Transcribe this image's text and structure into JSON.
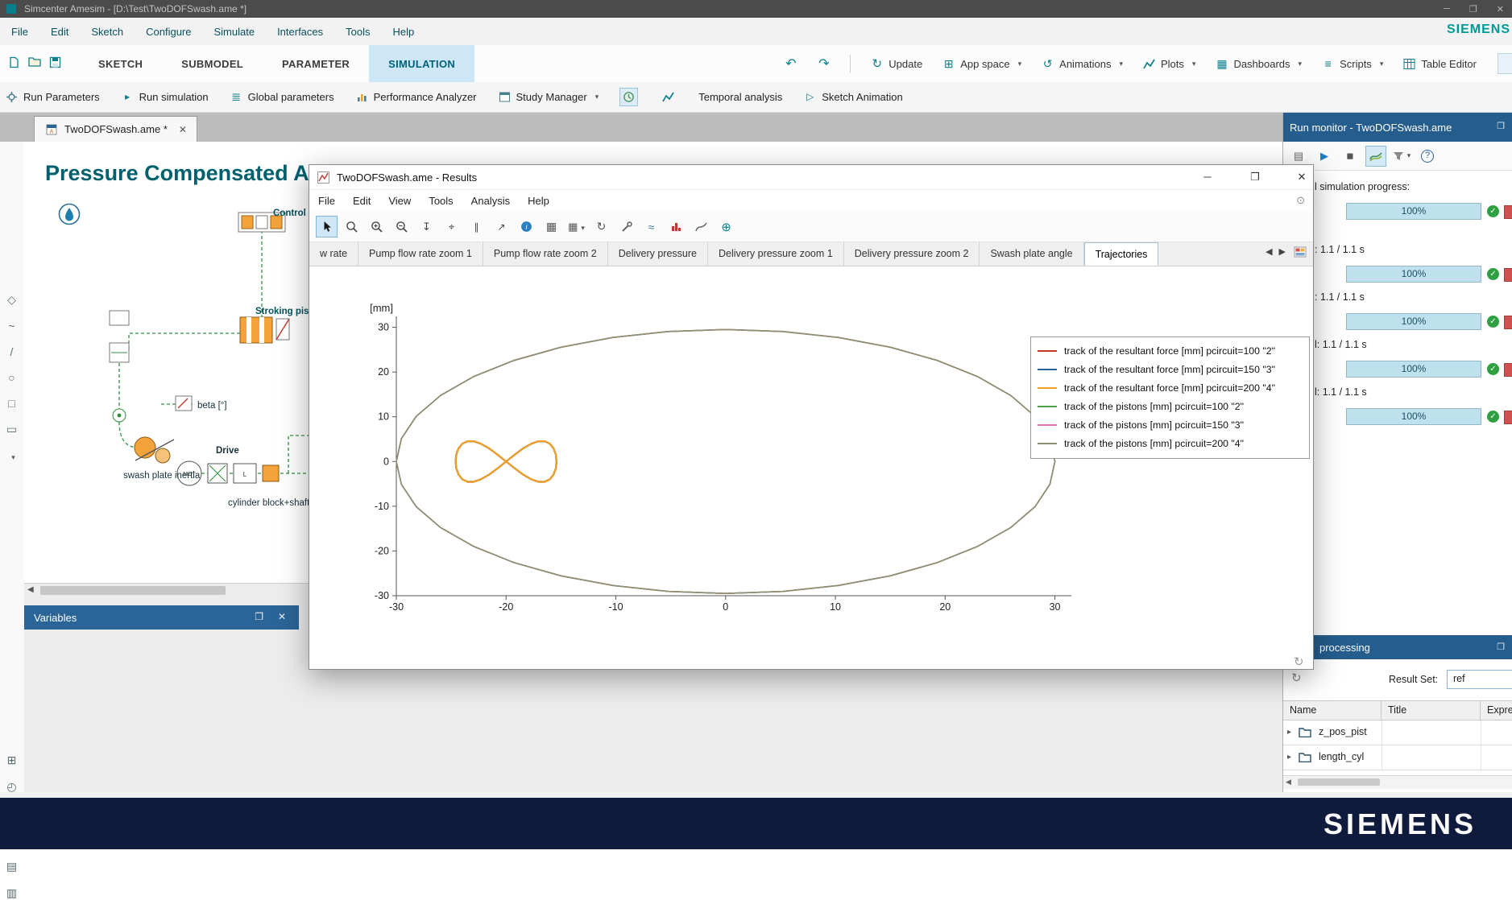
{
  "window": {
    "title": "Simcenter Amesim - [D:\\Test\\TwoDOFSwash.ame *]",
    "brand": "SIEMENS"
  },
  "menubar": {
    "items": [
      "File",
      "Edit",
      "Sketch",
      "Configure",
      "Simulate",
      "Interfaces",
      "Tools",
      "Help"
    ]
  },
  "mode_bar": {
    "file_actions": [
      "new",
      "open",
      "save"
    ],
    "tabs": [
      {
        "label": "SKETCH",
        "active": false
      },
      {
        "label": "SUBMODEL",
        "active": false
      },
      {
        "label": "PARAMETER",
        "active": false
      },
      {
        "label": "SIMULATION",
        "active": true
      }
    ],
    "actions": [
      {
        "label": "Update",
        "icon": "refresh",
        "chevron": false
      },
      {
        "label": "App space",
        "icon": "appspace",
        "chevron": true
      },
      {
        "label": "Animations",
        "icon": "animations",
        "chevron": true
      },
      {
        "label": "Plots",
        "icon": "plots",
        "chevron": true
      },
      {
        "label": "Dashboards",
        "icon": "dashboards",
        "chevron": true
      },
      {
        "label": "Scripts",
        "icon": "scripts",
        "chevron": true
      },
      {
        "label": "Table Editor",
        "icon": "tableeditor",
        "chevron": false
      }
    ]
  },
  "sim_toolbar": {
    "items": [
      {
        "label": "Run Parameters",
        "icon": "runparams",
        "chevron": false
      },
      {
        "label": "Run simulation",
        "icon": "runsim",
        "chevron": false
      },
      {
        "label": "Global parameters",
        "icon": "globalparams",
        "chevron": false
      },
      {
        "label": "Performance Analyzer",
        "icon": "perf",
        "chevron": false
      },
      {
        "label": "Study Manager",
        "icon": "study",
        "chevron": true
      },
      {
        "label": "",
        "icon": "temporal1",
        "chevron": false,
        "boxed": true
      },
      {
        "label": "",
        "icon": "temporal2",
        "chevron": false
      },
      {
        "label": "Temporal analysis",
        "icon": "",
        "chevron": false
      },
      {
        "label": "Sketch Animation",
        "icon": "sketchanim",
        "chevron": false
      }
    ]
  },
  "document_tabs": {
    "active": "TwoDOFSwash.ame *"
  },
  "left_rail": {
    "top": [
      "component",
      "signal",
      "line",
      "circle",
      "rect",
      "shape",
      "more"
    ],
    "bottom": [
      "grid",
      "clock",
      "plus",
      "target",
      "list",
      "panel"
    ]
  },
  "canvas": {
    "title": "Pressure Compensated Axial",
    "labels": {
      "control": "Control v",
      "stroking": "Stroking pist",
      "beta": "beta [°]",
      "swash": "swash plate inertia",
      "drive": "Drive",
      "cylinder": "cylinder block+shaft i"
    }
  },
  "variables_panel": {
    "title": "Variables"
  },
  "results_window": {
    "title": "TwoDOFSwash.ame - Results",
    "menus": [
      "File",
      "Edit",
      "View",
      "Tools",
      "Analysis",
      "Help"
    ],
    "toolbar": [
      "cursor",
      "zoomdyn",
      "zoomin",
      "zoomout",
      "markerv",
      "markerplus",
      "markerpair",
      "markerslope",
      "timeinfo",
      "table",
      "tablemenu",
      "refresh2",
      "tools",
      "waves",
      "histogram",
      "curveexp",
      "addcircle"
    ],
    "tabs": [
      "w rate",
      "Pump flow rate zoom 1",
      "Pump flow rate zoom 2",
      "Delivery pressure",
      "Delivery pressure zoom 1",
      "Delivery pressure zoom 2",
      "Swash plate angle",
      "Trajectories"
    ],
    "active_tab": "Trajectories"
  },
  "chart_data": {
    "type": "line",
    "title": "Trajectories",
    "xlabel": "",
    "ylabel": "[mm]",
    "xlim": [
      -30,
      31.5
    ],
    "ylim": [
      -30,
      31
    ],
    "xticks": [
      -30,
      -20,
      -10,
      0,
      10,
      20,
      30
    ],
    "yticks": [
      30,
      20,
      10,
      0,
      -10,
      -20,
      -30
    ],
    "grid": false,
    "legend_position": "upper right",
    "series": [
      {
        "name": "track of the resultant force [mm] pcircuit=100  \"2\"",
        "color": "#c0392b",
        "shape": "bowtie"
      },
      {
        "name": "track of the resultant force [mm] pcircuit=150  \"3\"",
        "color": "#2a6496",
        "shape": "bowtie"
      },
      {
        "name": "track of the resultant force [mm] pcircuit=200  \"4\"",
        "color": "#f0a125",
        "shape": "bowtie"
      },
      {
        "name": "track of the pistons [mm] pcircuit=100  \"2\"",
        "color": "#47a447",
        "shape": "ellipse"
      },
      {
        "name": "track of the pistons [mm] pcircuit=150  \"3\"",
        "color": "#d773ae",
        "shape": "ellipse"
      },
      {
        "name": "track of the pistons [mm] pcircuit=200  \"4\"",
        "color": "#8e8e72",
        "shape": "ellipse"
      }
    ],
    "shapes": {
      "ellipse": [
        [
          30,
          0
        ],
        [
          29.54,
          5.12
        ],
        [
          28.19,
          10.09
        ],
        [
          25.98,
          14.75
        ],
        [
          22.98,
          18.96
        ],
        [
          19.28,
          22.6
        ],
        [
          15,
          25.55
        ],
        [
          10.26,
          27.72
        ],
        [
          5.21,
          29.05
        ],
        [
          0,
          29.5
        ],
        [
          -5.21,
          29.05
        ],
        [
          -10.26,
          27.72
        ],
        [
          -15,
          25.55
        ],
        [
          -19.28,
          22.6
        ],
        [
          -22.98,
          18.96
        ],
        [
          -25.98,
          14.75
        ],
        [
          -28.19,
          10.09
        ],
        [
          -29.54,
          5.12
        ],
        [
          -30,
          0
        ],
        [
          -29.54,
          -5.12
        ],
        [
          -28.19,
          -10.09
        ],
        [
          -25.98,
          -14.75
        ],
        [
          -22.98,
          -18.96
        ],
        [
          -19.28,
          -22.6
        ],
        [
          -15,
          -25.55
        ],
        [
          -10.26,
          -27.72
        ],
        [
          -5.21,
          -29.05
        ],
        [
          0,
          -29.5
        ],
        [
          5.21,
          -29.05
        ],
        [
          10.26,
          -27.72
        ],
        [
          15,
          -25.55
        ],
        [
          19.28,
          -22.6
        ],
        [
          22.98,
          -18.96
        ],
        [
          25.98,
          -14.75
        ],
        [
          28.19,
          -10.09
        ],
        [
          29.54,
          -5.12
        ],
        [
          30,
          0
        ]
      ],
      "bowtie": [
        [
          -15.4,
          0
        ],
        [
          -15.47,
          1.57
        ],
        [
          -15.68,
          2.96
        ],
        [
          -16.02,
          3.98
        ],
        [
          -16.48,
          4.53
        ],
        [
          -17.04,
          4.53
        ],
        [
          -17.7,
          3.98
        ],
        [
          -18.43,
          2.96
        ],
        [
          -19.2,
          1.57
        ],
        [
          -20,
          0
        ],
        [
          -20.8,
          -1.57
        ],
        [
          -21.57,
          -2.96
        ],
        [
          -22.3,
          -3.98
        ],
        [
          -22.96,
          -4.53
        ],
        [
          -23.52,
          -4.53
        ],
        [
          -23.98,
          -3.98
        ],
        [
          -24.32,
          -2.96
        ],
        [
          -24.53,
          -1.57
        ],
        [
          -24.6,
          0
        ],
        [
          -24.53,
          1.57
        ],
        [
          -24.32,
          2.96
        ],
        [
          -23.98,
          3.98
        ],
        [
          -23.52,
          4.53
        ],
        [
          -22.96,
          4.53
        ],
        [
          -22.3,
          3.98
        ],
        [
          -21.57,
          2.96
        ],
        [
          -20.8,
          1.57
        ],
        [
          -20,
          0
        ],
        [
          -19.2,
          -1.57
        ],
        [
          -18.43,
          -2.96
        ],
        [
          -17.7,
          -3.98
        ],
        [
          -17.04,
          -4.53
        ],
        [
          -16.48,
          -4.53
        ],
        [
          -16.02,
          -3.98
        ],
        [
          -15.68,
          -2.96
        ],
        [
          -15.47,
          -1.57
        ],
        [
          -15.4,
          0
        ]
      ]
    }
  },
  "run_monitor": {
    "title": "Run monitor - TwoDOFSwash.ame",
    "toolbar": [
      "monitor",
      "play",
      "stop",
      "plotcurves",
      "filter",
      "help"
    ],
    "progress_groups": [
      {
        "label": "l simulation progress:",
        "value": 100,
        "text": "100%"
      },
      {
        "label": ": 1.1 / 1.1 s",
        "value": 100,
        "text": "100%"
      },
      {
        "label": ": 1.1 / 1.1 s",
        "value": 100,
        "text": "100%"
      },
      {
        "label": "l: 1.1 / 1.1 s",
        "value": 100,
        "text": "100%"
      },
      {
        "label": "l: 1.1 / 1.1 s",
        "value": 100,
        "text": "100%"
      }
    ]
  },
  "post_processing": {
    "title": "processing",
    "result_set_label": "Result Set:",
    "result_set_value": "ref",
    "columns": [
      "Name",
      "Title",
      "Expres"
    ],
    "rows": [
      {
        "name": "z_pos_pist"
      },
      {
        "name": "length_cyl"
      }
    ]
  },
  "footer": {
    "brand": "SIEMENS"
  }
}
